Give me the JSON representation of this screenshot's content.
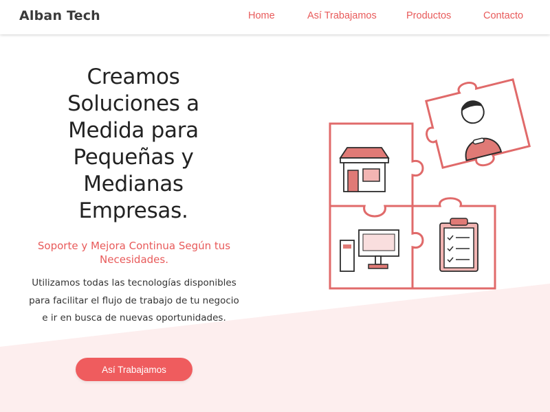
{
  "brand": {
    "name": "Alban Tech"
  },
  "nav": {
    "items": [
      {
        "label": "Home"
      },
      {
        "label": "Así Trabajamos"
      },
      {
        "label": "Productos"
      },
      {
        "label": "Contacto"
      }
    ]
  },
  "hero": {
    "title": "Creamos Soluciones a Medida para Pequeñas y Medianas Empresas.",
    "subtitle": "Soporte y Mejora Continua Según tus Necesidades.",
    "description": "Utilizamos todas las tecnologías disponibles para facilitar el flujo de trabajo de tu negocio e ir en busca de nuevas oportunidades.",
    "cta_label": "Así Trabajamos"
  },
  "colors": {
    "accent": "#ef5c5e",
    "nav_link": "#e85a5a",
    "background_shape": "#fdeeee",
    "text_dark": "#222222"
  },
  "illustration": {
    "icons": [
      "store-icon",
      "person-icon",
      "computer-icon",
      "clipboard-icon"
    ]
  }
}
